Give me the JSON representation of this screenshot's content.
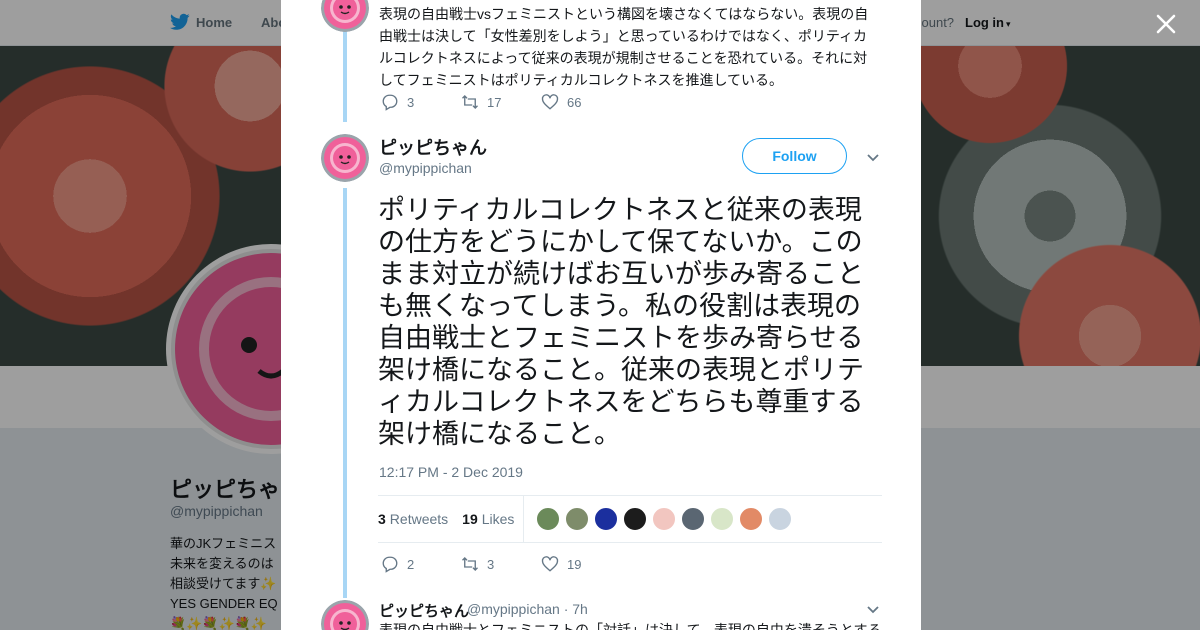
{
  "nav": {
    "home": "Home",
    "about": "Abo",
    "account_prompt": "count?",
    "login": "Log in"
  },
  "background_profile": {
    "name": "ピッピちゃ",
    "handle": "@mypippichan",
    "bio_lines": [
      "華のJKフェミニス",
      "未来を変えるのは",
      "相談受けてます✨",
      "YES GENDER EQ",
      "💐✨💐✨💐✨"
    ]
  },
  "colors": {
    "accent": "#1da1f2",
    "thread_line": "#a8d6f5",
    "avatar_pink": "#f0609a"
  },
  "previous_tweet": {
    "text": "表現の自由戦士vsフェミニストという構図を壊さなくてはならない。表現の自由戦士は決して「女性差別をしよう」と思っているわけではなく、ポリティカルコレクトネスによって従来の表現が規制させることを恐れている。それに対してフェミニストはポリティカルコレクトネスを推進している。",
    "replies": "3",
    "retweets": "17",
    "likes": "66"
  },
  "main_tweet": {
    "name": "ピッピちゃん",
    "handle": "@mypippichan",
    "follow_label": "Follow",
    "text": "ポリティカルコレクトネスと従来の表現の仕方をどうにかして保てないか。このまま対立が続けばお互いが歩み寄ることも無くなってしまう。私の役割は表現の自由戦士とフェミニストを歩み寄らせる架け橋になること。従来の表現とポリティカルコレクトネスをどちらも尊重する架け橋になること。",
    "timestamp": "12:17 PM - 2 Dec 2019",
    "retweet_count": "3",
    "retweet_label": "Retweets",
    "like_count": "19",
    "like_label": "Likes",
    "likers": [
      "#6b8a5a",
      "#7e8c6a",
      "#1b2f9e",
      "#1c1c1c",
      "#f2c6c0",
      "#5a6672",
      "#d8e6c8",
      "#e28a66",
      "#c9d4e0"
    ],
    "replies": "2",
    "retweets": "3",
    "likes": "19"
  },
  "reply_tweet": {
    "name": "ピッピちゃん",
    "handle": "@mypippichan",
    "time": "· 7h",
    "text": "表現の自由戦士とフェミニストの「対話」は決して、表現の自由を潰そうとする"
  }
}
